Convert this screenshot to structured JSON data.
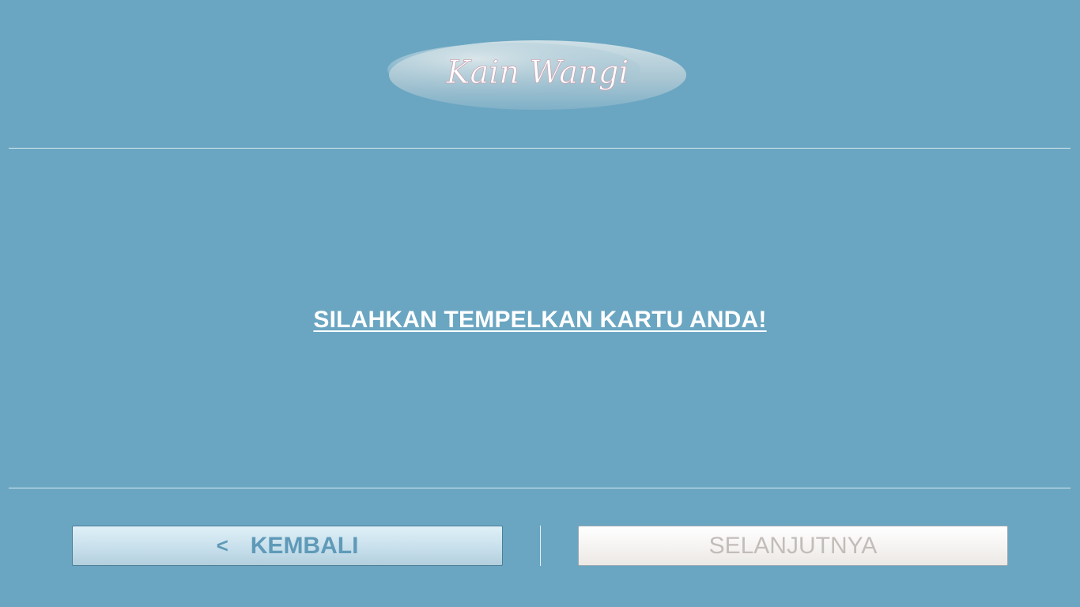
{
  "logo": {
    "text": "Kain Wangi"
  },
  "prompt": {
    "text": "SILAHKAN TEMPELKAN KARTU ANDA!"
  },
  "buttons": {
    "back_icon": "<",
    "back_label": "KEMBALI",
    "next_label": "SELANJUTNYA"
  },
  "colors": {
    "background": "#6aa6c2",
    "back_text": "#5f9ab8",
    "next_text_disabled": "#c2bdb9"
  }
}
